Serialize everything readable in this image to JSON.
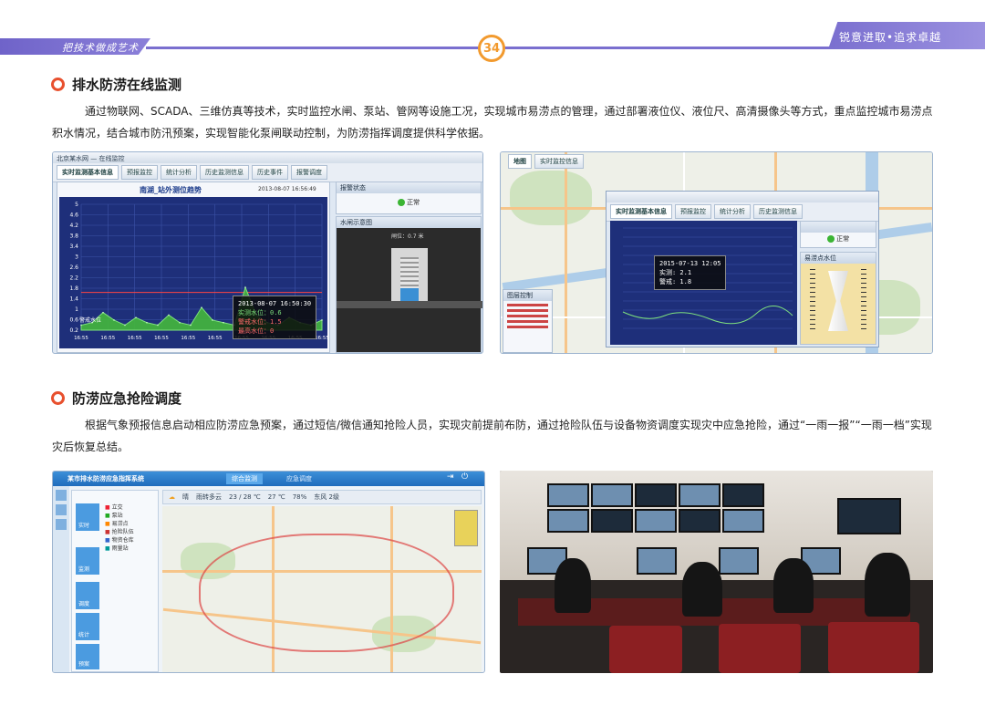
{
  "header": {
    "left_slogan": "把技术做成艺术",
    "right_slogan": "锐意进取•追求卓越",
    "page_number": "34",
    "accent_color": "#7a6fcf",
    "page_number_color": "#f29a2e"
  },
  "section1": {
    "title": "排水防涝在线监测",
    "paragraph": "通过物联网、SCADA、三维仿真等技术，实时监控水闸、泵站、管网等设施工况，实现城市易涝点的管理，通过部署液位仪、液位尺、高清摄像头等方式，重点监控城市易涝点积水情况，结合城市防汛预案，实现智能化泵闸联动控制，为防涝指挥调度提供科学依据。",
    "screenshot_left": {
      "window_title": "北京某水网 — 在线监控",
      "tabs": [
        "实时监测基本信息",
        "预报监控",
        "统计分析",
        "历史监测信息",
        "历史事件",
        "报警调度"
      ],
      "chart_title": "南湖_站外测位趋势",
      "chart_time": "2013-08-07 16:56:49",
      "tooltip": {
        "time": "2013-08-07 16:50:30",
        "lines": [
          "实测水位：0.6",
          "警戒水位：1.5",
          "最高水位：0"
        ]
      },
      "warning_label": "警戒水位",
      "status_panel_title": "报警状态",
      "status_text": "正常",
      "gate_panel_title": "水闸示意图",
      "gate_label": "闸位：0.7 米"
    },
    "screenshot_right": {
      "tabs": [
        "地图",
        "实时监控信息"
      ],
      "tooltip_lines": [
        "2015-07-13 12:05",
        "实测: 2.1",
        "警戒: 1.8"
      ],
      "status_text": "正常",
      "gauge_label": "易涝点水位",
      "layer_title": "图层控制"
    }
  },
  "section2": {
    "title": "防涝应急抢险调度",
    "paragraph": "根据气象预报信息启动相应防涝应急预案，通过短信/微信通知抢险人员，实现灾前提前布防，通过抢险队伍与设备物资调度实现灾中应急抢险，通过“一雨一报”“一雨一档”实现灾后恢复总结。",
    "screenshot_left": {
      "app_title": "某市排水防涝应急指挥系统",
      "tabs": [
        "综合监测",
        "应急调度"
      ],
      "weather": [
        "晴",
        "雨转多云",
        "23 / 28 ℃",
        "27 ℃",
        "78%",
        "东风 2级"
      ],
      "legend": [
        "立交",
        "泵站",
        "易涝点",
        "抢险队伍",
        "物资仓库",
        "雨量站"
      ],
      "left_nav": [
        "实时",
        "监测",
        "调度",
        "统计",
        "预案"
      ]
    }
  },
  "chart_data": {
    "type": "area",
    "title": "南湖_站外测位趋势",
    "ylim": [
      0,
      5
    ],
    "y_ticks": [
      "5",
      "4.6",
      "4.2",
      "3.8",
      "3.4",
      "3",
      "2.6",
      "2.2",
      "1.8",
      "1.4",
      "1",
      "0.6",
      "0.2"
    ],
    "x_ticks": [
      "16:55",
      "16:55",
      "16:55",
      "16:55",
      "16:55",
      "16:55",
      "16:55",
      "16:55",
      "16:55",
      "16:55"
    ],
    "series": [
      {
        "values": [
          0.2,
          0.3,
          0.7,
          0.4,
          0.2,
          0.5,
          0.3,
          0.2,
          0.6,
          0.3,
          0.2,
          0.9,
          0.4,
          0.3,
          0.2,
          1.7,
          0.6,
          0.3,
          0.2,
          0.5,
          0.3,
          0.2,
          0.4
        ]
      }
    ],
    "warning_level": 1.5
  }
}
